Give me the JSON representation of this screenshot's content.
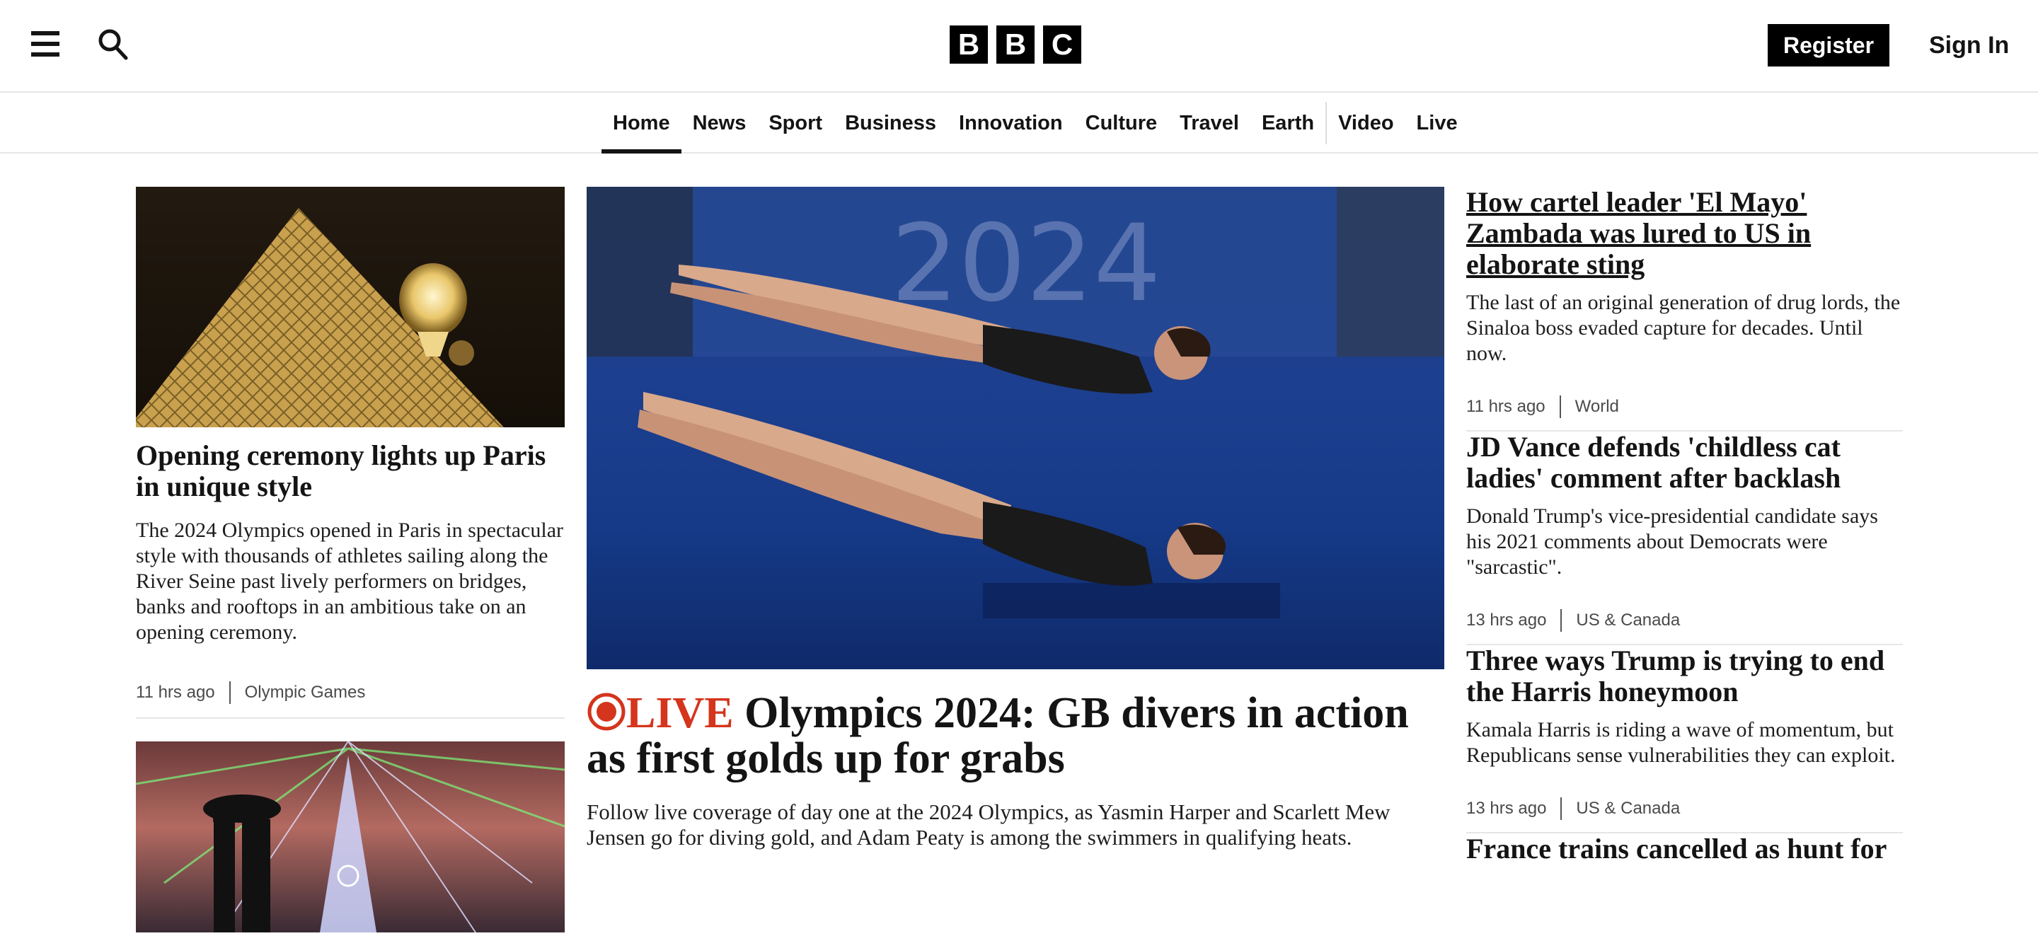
{
  "header": {
    "logo_letters": [
      "B",
      "B",
      "C"
    ],
    "register_label": "Register",
    "signin_label": "Sign In",
    "menu_icon": "hamburger-menu-icon",
    "search_icon": "search-icon"
  },
  "nav": {
    "items": [
      "Home",
      "News",
      "Sport",
      "Business",
      "Innovation",
      "Culture",
      "Travel",
      "Earth",
      "Video",
      "Live"
    ],
    "active": "Home"
  },
  "left": {
    "story1": {
      "headline": "Opening ceremony lights up Paris in unique style",
      "summary": "The 2024 Olympics opened in Paris in spectacular style with thousands of athletes sailing along the River Seine past lively performers on bridges, banks and rooftops in an ambitious take on an opening ceremony.",
      "time": "11 hrs ago",
      "section": "Olympic Games"
    }
  },
  "main": {
    "live_label": "LIVE",
    "headline": "Olympics 2024: GB divers in action as first golds up for grabs",
    "summary": "Follow live coverage of day one at the 2024 Olympics, as Yasmin Harper and Scarlett Mew Jensen go for diving gold, and Adam Peaty is among the swimmers in qualifying heats.",
    "image_text": "2024"
  },
  "right": {
    "stories": [
      {
        "headline": "How cartel leader 'El Mayo' Zambada was lured to US in elaborate sting",
        "summary": "The last of an original generation of drug lords, the Sinaloa boss evaded capture for decades. Until now.",
        "time": "11 hrs ago",
        "section": "World"
      },
      {
        "headline": "JD Vance defends 'childless cat ladies' comment after backlash",
        "summary": "Donald Trump's vice-presidential candidate says his 2021 comments about Democrats were \"sarcastic\".",
        "time": "13 hrs ago",
        "section": "US & Canada"
      },
      {
        "headline": "Three ways Trump is trying to end the Harris honeymoon",
        "summary": "Kamala Harris is riding a wave of momentum, but Republicans sense vulnerabilities they can exploit.",
        "time": "13 hrs ago",
        "section": "US & Canada"
      },
      {
        "headline": "France trains cancelled as hunt for"
      }
    ]
  },
  "colors": {
    "live_red": "#d4351c",
    "text": "#141414",
    "rule": "#e6e6e6"
  }
}
